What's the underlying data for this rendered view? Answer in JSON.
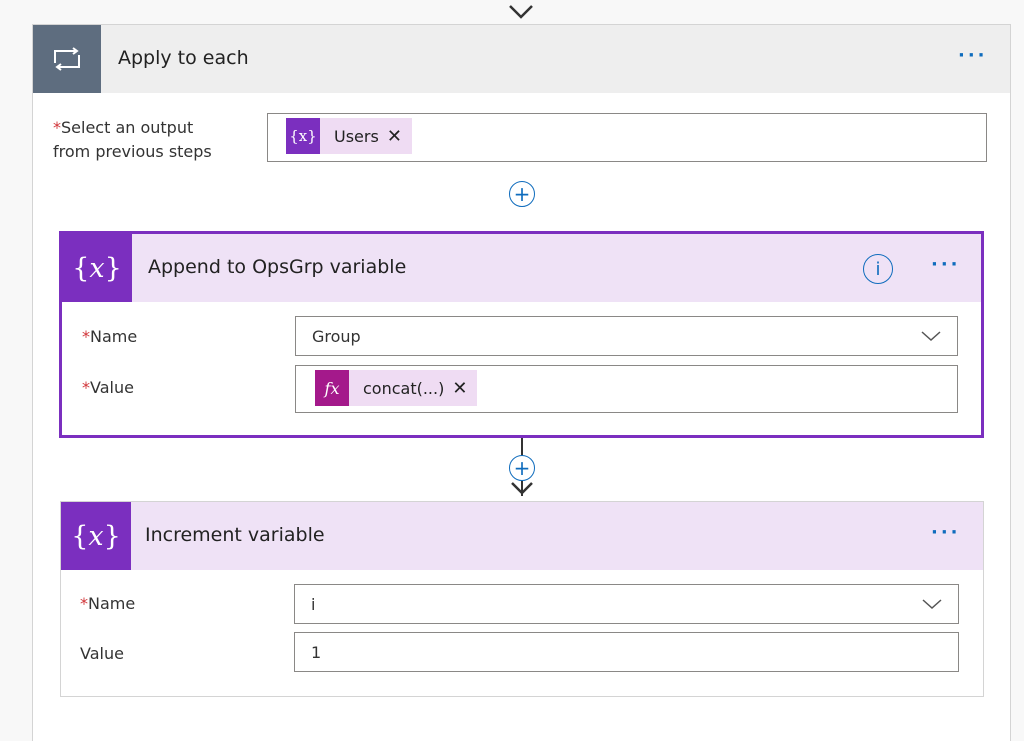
{
  "apply_to_each": {
    "title": "Apply to each",
    "more": "···",
    "select_output": {
      "label_line1": "Select an output",
      "label_line2": "from previous steps",
      "token_icon": "{x}",
      "token_label": "Users",
      "token_remove": "✕"
    }
  },
  "append_card": {
    "title": "Append to OpsGrp variable",
    "info": "i",
    "more": "···",
    "name_label": "Name",
    "name_value": "Group",
    "value_label": "Value",
    "value_token_icon": "fx",
    "value_token_label": "concat(...)",
    "value_token_remove": "✕"
  },
  "increment_card": {
    "title": "Increment variable",
    "more": "···",
    "name_label": "Name",
    "name_value": "i",
    "value_label": "Value",
    "value_value": "1"
  },
  "icons": {
    "loop": "loop-icon",
    "variable": "variable-icon",
    "function": "function-icon",
    "add": "add-step-icon",
    "chevron": "chevron-down-icon",
    "info": "info-icon"
  },
  "colors": {
    "accent_blue": "#0f6cbd",
    "variable_purple": "#7b2fbf",
    "expression_magenta": "#a4198b",
    "loop_gray": "#5e6d7f",
    "card_header_tint": "#efe2f6",
    "selected_border": "#7b2fbf",
    "required_red": "#d13438"
  }
}
